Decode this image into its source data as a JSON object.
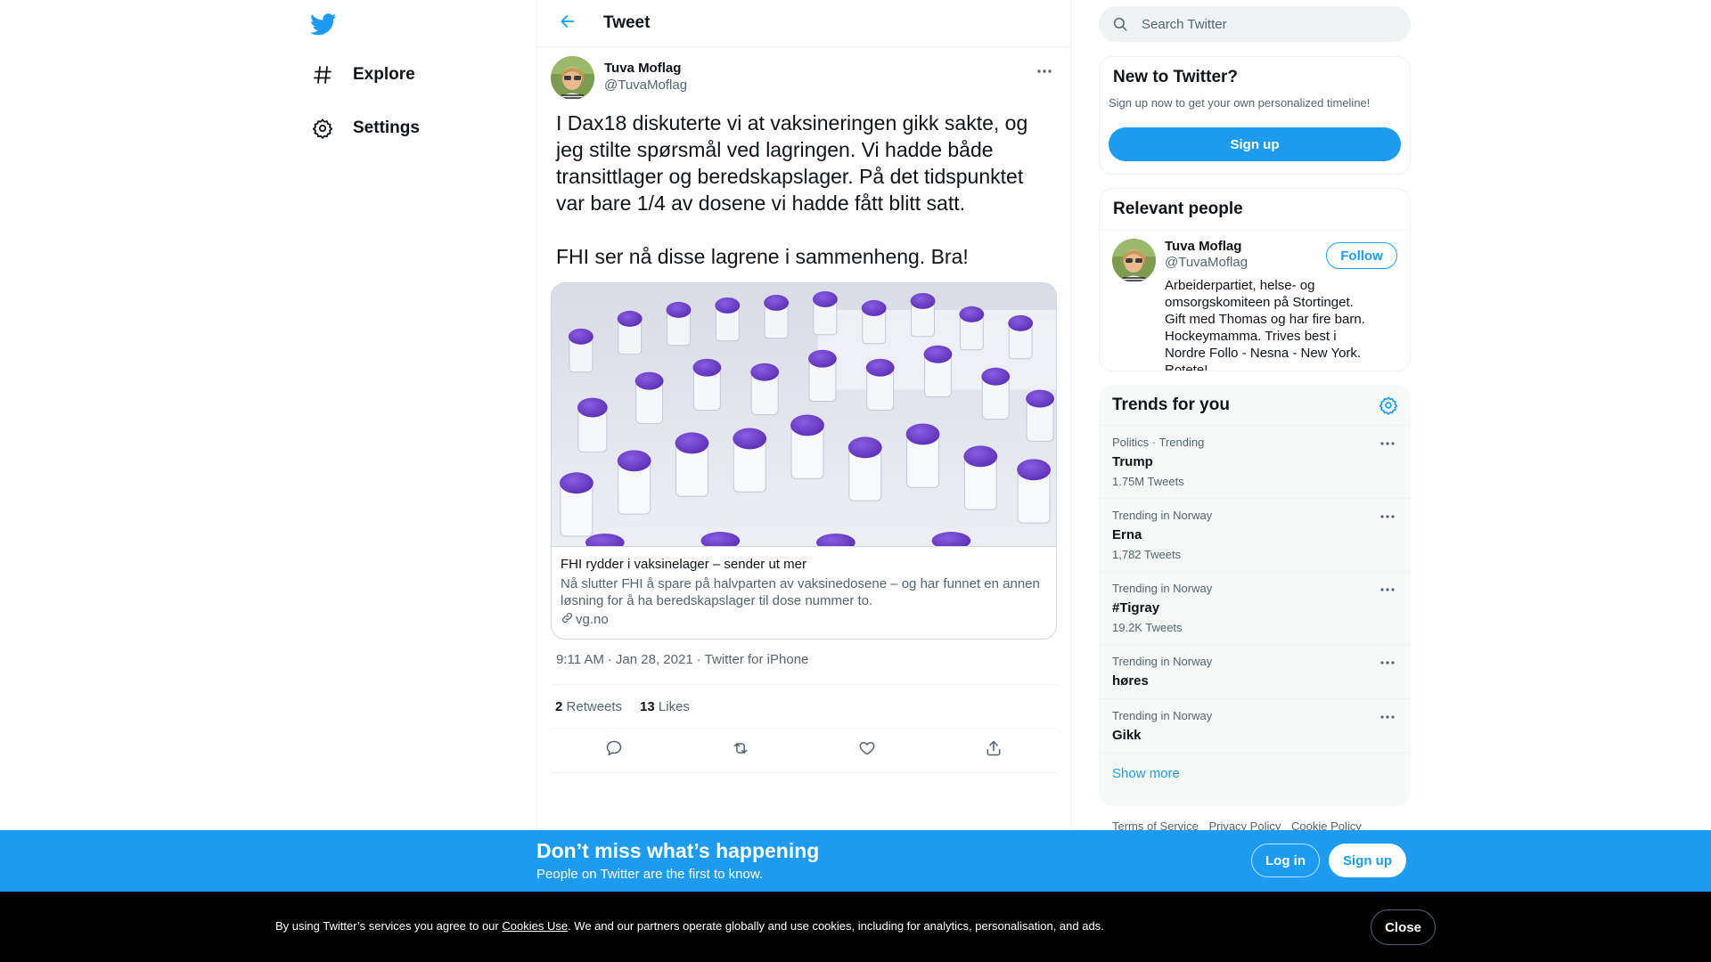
{
  "nav": {
    "logo": "twitter-bird-icon",
    "items": [
      {
        "label": "Explore",
        "icon": "hashtag-icon"
      },
      {
        "label": "Settings",
        "icon": "gear-icon"
      }
    ]
  },
  "header": {
    "title": "Tweet"
  },
  "tweet": {
    "author_name": "Tuva Moflag",
    "author_handle": "@TuvaMoflag",
    "text_p1": "I Dax18 diskuterte vi at vaksineringen gikk sakte, og jeg stilte spørsmål ved lagringen. Vi hadde både transittlager og beredskapslager. På det tidspunktet var bare 1/4 av dosene vi hadde fått blitt satt.",
    "text_p2": "FHI ser nå disse lagrene i sammenheng. Bra!",
    "card": {
      "title": "FHI rydder i vaksinelager – sender ut mer",
      "description": "Nå slutter FHI å spare på halvparten av vaksinedosene – og har funnet en annen løsning for å ha beredskapslager til dose nummer to.",
      "domain": "vg.no"
    },
    "time": "9:11 AM",
    "date": "Jan 28, 2021",
    "source": "Twitter for iPhone",
    "retweets": "2",
    "retweets_label": "Retweets",
    "likes": "13",
    "likes_label": "Likes"
  },
  "search": {
    "placeholder": "Search Twitter"
  },
  "new_to_twitter": {
    "title": "New to Twitter?",
    "subtitle": "Sign up now to get your own personalized timeline!",
    "button": "Sign up"
  },
  "relevant_people": {
    "title": "Relevant people",
    "person": {
      "name": "Tuva Moflag",
      "handle": "@TuvaMoflag",
      "bio": "Arbeiderpartiet, helse- og omsorgskomiteen på Stortinget. Gift med Thomas og har fire barn. Hockeymamma. Trives best i Nordre Follo - Nesna - New York. Rotete!",
      "follow": "Follow"
    }
  },
  "trends": {
    "title": "Trends for you",
    "items": [
      {
        "context": "Politics · Trending",
        "name": "Trump",
        "count": "1.75M Tweets"
      },
      {
        "context": "Trending in Norway",
        "name": "Erna",
        "count": "1,782 Tweets"
      },
      {
        "context": "Trending in Norway",
        "name": "#Tigray",
        "count": "19.2K Tweets"
      },
      {
        "context": "Trending in Norway",
        "name": "høres",
        "count": ""
      },
      {
        "context": "Trending in Norway",
        "name": "Gikk",
        "count": ""
      }
    ],
    "show_more": "Show more"
  },
  "footer_links": [
    "Terms of Service",
    "Privacy Policy",
    "Cookie Policy"
  ],
  "bottom_bar": {
    "title": "Don’t miss what’s happening",
    "subtitle": "People on Twitter are the first to know.",
    "login": "Log in",
    "signup": "Sign up"
  },
  "cookie_bar": {
    "text_before": "By using Twitter’s services you agree to our ",
    "link": "Cookies Use",
    "text_after": ". We and our partners operate globally and use cookies, including for analytics, personalisation, and ads.",
    "close": "Close"
  },
  "colors": {
    "accent": "#1d9bf0",
    "text": "#0f1419",
    "secondary": "#536471",
    "vial_cap": "#6a3ec9"
  }
}
